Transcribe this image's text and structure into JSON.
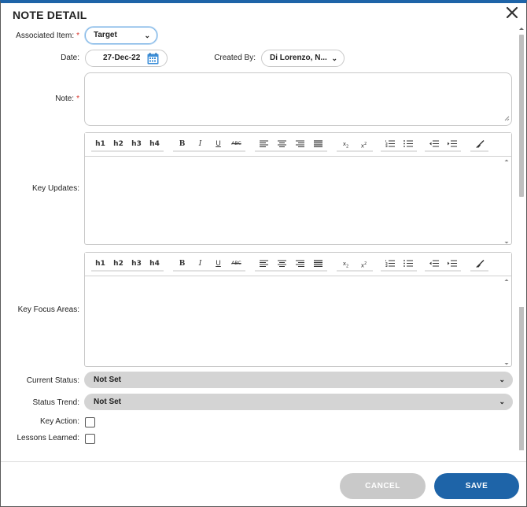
{
  "dialog": {
    "title": "NOTE DETAIL"
  },
  "fields": {
    "associated_item": {
      "label": "Associated Item:",
      "value": "Target"
    },
    "date": {
      "label": "Date:",
      "value": "27-Dec-22"
    },
    "created_by": {
      "label": "Created By:",
      "value": "Di Lorenzo, N..."
    },
    "note": {
      "label": "Note:"
    },
    "key_updates": {
      "label": "Key Updates:"
    },
    "key_focus_areas": {
      "label": "Key Focus Areas:"
    },
    "current_status": {
      "label": "Current Status:",
      "value": "Not Set"
    },
    "status_trend": {
      "label": "Status Trend:",
      "value": "Not Set"
    },
    "key_action": {
      "label": "Key Action:",
      "checked": false
    },
    "lessons_learned": {
      "label": "Lessons Learned:",
      "checked": false
    }
  },
  "required_marker": "*",
  "toolbar": {
    "h1": "h1",
    "h2": "h2",
    "h3": "h3",
    "h4": "h4",
    "bold": "B",
    "italic": "I",
    "underline": "U",
    "strike": "ABC",
    "subscript": "x",
    "superscript": "x"
  },
  "icons": {
    "close": "close-icon",
    "calendar": "calendar-icon",
    "chevron": "chevron-down-icon",
    "align_left": "align-left-icon",
    "align_center": "align-center-icon",
    "align_right": "align-right-icon",
    "align_justify": "align-justify-icon",
    "ordered_list": "ordered-list-icon",
    "bullet_list": "bullet-list-icon",
    "outdent": "outdent-icon",
    "indent": "indent-icon",
    "clear_format": "clear-format-icon"
  },
  "footer": {
    "cancel_label": "CANCEL",
    "save_label": "SAVE"
  },
  "colors": {
    "accent": "#1e64a8",
    "required": "#d9342b",
    "disabled": "#c9c9c9",
    "select_bg": "#d4d4d4"
  }
}
